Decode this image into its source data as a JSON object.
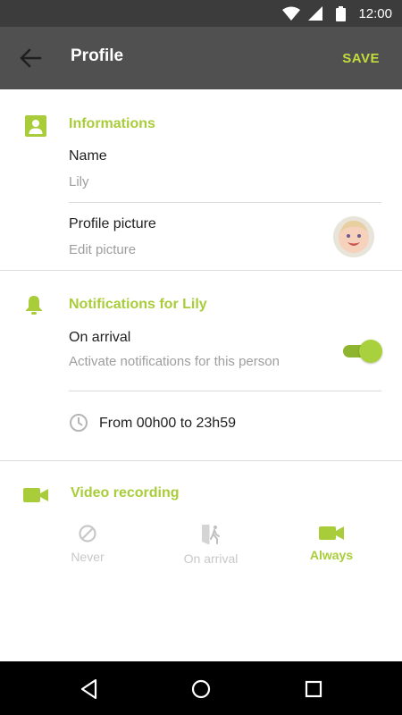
{
  "status_bar": {
    "time": "12:00",
    "icons": [
      "wifi-icon",
      "signal-icon",
      "battery-icon"
    ]
  },
  "app_bar": {
    "title": "Profile",
    "save_label": "SAVE",
    "back_icon": "arrow-back-icon"
  },
  "informations": {
    "title": "Informations",
    "icon": "person-card-icon",
    "name_label": "Name",
    "name_value": "Lily",
    "picture_label": "Profile picture",
    "picture_action": "Edit picture"
  },
  "notifications": {
    "title": "Notifications for Lily",
    "icon": "bell-icon",
    "arrival_label": "On arrival",
    "arrival_desc": "Activate notifications for this person",
    "arrival_enabled": true,
    "time_icon": "clock-icon",
    "time_range": "From 00h00 to 23h59"
  },
  "video": {
    "title": "Video recording",
    "icon": "video-camera-icon",
    "options": [
      {
        "label": "Never",
        "icon": "blocked-icon",
        "selected": false
      },
      {
        "label": "On arrival",
        "icon": "walk-in-door-icon",
        "selected": false
      },
      {
        "label": "Always",
        "icon": "video-camera-icon",
        "selected": true
      }
    ]
  },
  "colors": {
    "accent": "#a9cd3a",
    "app_bar": "#505050",
    "status_bar": "#3c3c3c",
    "text_primary": "#212121",
    "text_secondary": "#9e9e9e",
    "disabled": "#c8c8c8"
  },
  "nav_bar": {
    "buttons": [
      "back-triangle-icon",
      "home-circle-icon",
      "recents-square-icon"
    ]
  }
}
